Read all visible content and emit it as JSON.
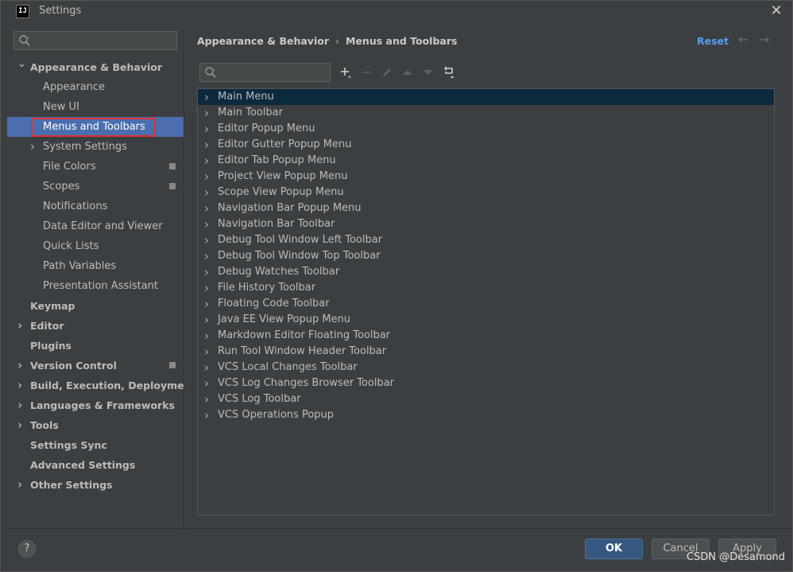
{
  "window": {
    "title": "Settings",
    "logo_text": "IJ"
  },
  "sidebar": {
    "search_placeholder": "",
    "items": [
      {
        "label": "Appearance & Behavior",
        "bold": true,
        "expanded": true,
        "indent": 0
      },
      {
        "label": "Appearance",
        "indent": 1
      },
      {
        "label": "New UI",
        "indent": 1
      },
      {
        "label": "Menus and Toolbars",
        "indent": 1,
        "selected": true
      },
      {
        "label": "System Settings",
        "indent": 1,
        "collapsed": true
      },
      {
        "label": "File Colors",
        "indent": 1,
        "cfg": true
      },
      {
        "label": "Scopes",
        "indent": 1,
        "cfg": true
      },
      {
        "label": "Notifications",
        "indent": 1
      },
      {
        "label": "Data Editor and Viewer",
        "indent": 1
      },
      {
        "label": "Quick Lists",
        "indent": 1
      },
      {
        "label": "Path Variables",
        "indent": 1
      },
      {
        "label": "Presentation Assistant",
        "indent": 1
      },
      {
        "label": "Keymap",
        "bold": true,
        "indent": 0
      },
      {
        "label": "Editor",
        "bold": true,
        "collapsed": true,
        "indent": 0
      },
      {
        "label": "Plugins",
        "bold": true,
        "indent": 0
      },
      {
        "label": "Version Control",
        "bold": true,
        "collapsed": true,
        "cfg": true,
        "indent": 0
      },
      {
        "label": "Build, Execution, Deployment",
        "bold": true,
        "collapsed": true,
        "indent": 0
      },
      {
        "label": "Languages & Frameworks",
        "bold": true,
        "collapsed": true,
        "indent": 0
      },
      {
        "label": "Tools",
        "bold": true,
        "collapsed": true,
        "indent": 0
      },
      {
        "label": "Settings Sync",
        "bold": true,
        "indent": 0
      },
      {
        "label": "Advanced Settings",
        "bold": true,
        "indent": 0
      },
      {
        "label": "Other Settings",
        "bold": true,
        "collapsed": true,
        "indent": 0
      }
    ]
  },
  "main": {
    "breadcrumb": {
      "parent": "Appearance & Behavior",
      "separator": "›",
      "current": "Menus and Toolbars"
    },
    "reset_label": "Reset",
    "toolbar_search_placeholder": "",
    "list": [
      "Main Menu",
      "Main Toolbar",
      "Editor Popup Menu",
      "Editor Gutter Popup Menu",
      "Editor Tab Popup Menu",
      "Project View Popup Menu",
      "Scope View Popup Menu",
      "Navigation Bar Popup Menu",
      "Navigation Bar Toolbar",
      "Debug Tool Window Left Toolbar",
      "Debug Tool Window Top Toolbar",
      "Debug Watches Toolbar",
      "File History Toolbar",
      "Floating Code Toolbar",
      "Java EE View Popup Menu",
      "Markdown Editor Floating Toolbar",
      "Run Tool Window Header Toolbar",
      "VCS Local Changes Toolbar",
      "VCS Log Changes Browser Toolbar",
      "VCS Log Toolbar",
      "VCS Operations Popup"
    ]
  },
  "footer": {
    "help_label": "?",
    "ok_label": "OK",
    "cancel_label": "Cancel",
    "apply_label": "Apply"
  },
  "watermark": "CSDN @Desamond",
  "colors": {
    "background": "#3c3f41",
    "selection": "#4b6eaf",
    "list_selection": "#0d293e",
    "accent_link": "#589df6",
    "highlight_box": "#e0302f",
    "ok_button": "#365880"
  }
}
